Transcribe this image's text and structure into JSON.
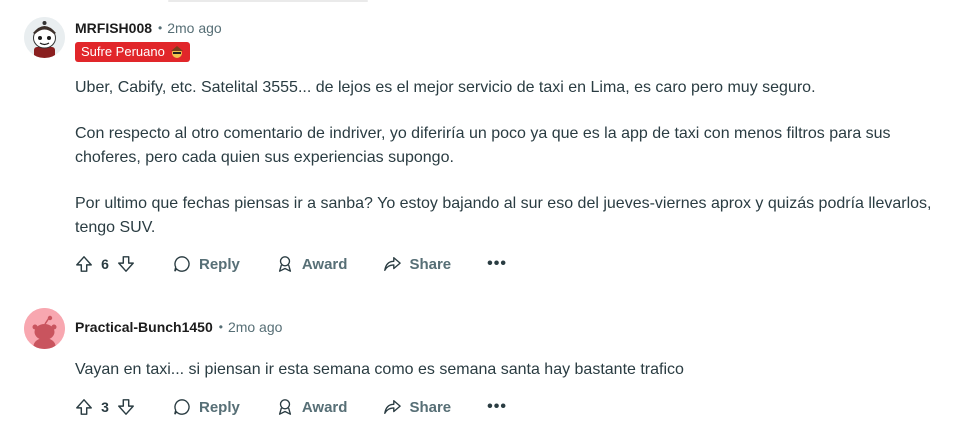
{
  "comments": [
    {
      "username": "MRFISH008",
      "separator": "•",
      "time": "2mo ago",
      "flair": "Sufre Peruano",
      "paragraphs": [
        "Uber, Cabify, etc. Satelital 3555... de lejos es el mejor servicio de taxi en Lima, es caro pero muy seguro.",
        "Con respecto al otro comentario de indriver, yo diferiría un poco ya que es la app de taxi con menos filtros para sus choferes, pero cada quien sus experiencias supongo.",
        "Por ultimo que fechas piensas ir a sanba? Yo estoy bajando al sur eso del jueves-viernes aprox y quizás podría llevarlos, tengo SUV."
      ],
      "score": "6",
      "actions": {
        "reply": "Reply",
        "award": "Award",
        "share": "Share",
        "more": "•••"
      },
      "avatar_icon": "snoo-avatar-icon",
      "avatar_bg": "#e9eef0"
    },
    {
      "username": "Practical-Bunch1450",
      "separator": "•",
      "time": "2mo ago",
      "paragraphs": [
        "Vayan en taxi... si piensan ir esta semana como es semana santa hay bastante trafico"
      ],
      "score": "3",
      "actions": {
        "reply": "Reply",
        "award": "Award",
        "share": "Share",
        "more": "•••"
      },
      "avatar_icon": "default-snoo-avatar-icon",
      "avatar_bg": "#f8a7b0"
    }
  ],
  "colors": {
    "flair_bg": "#e1262a",
    "meta_text": "#576f76",
    "body_text": "#2a3c42"
  }
}
